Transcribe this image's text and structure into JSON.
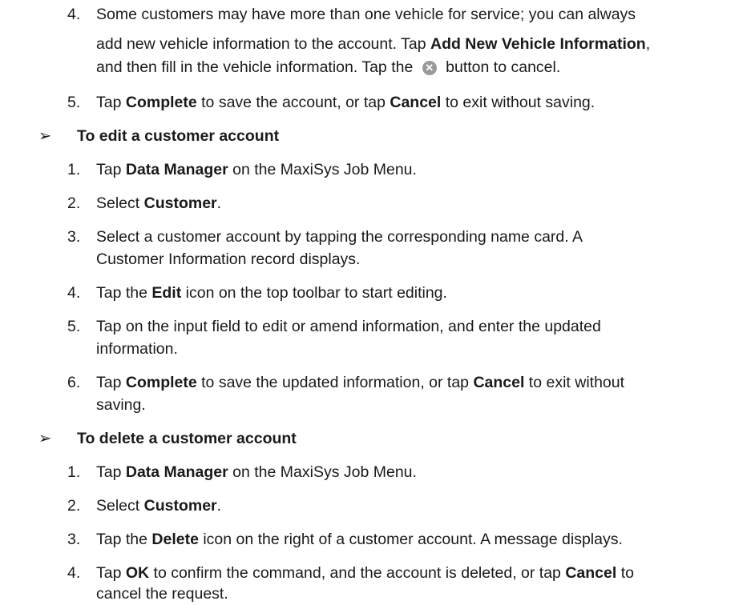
{
  "pre_steps": [
    {
      "num": "4.",
      "line1_a": "Some customers may have more than one vehicle for service; you can always",
      "line2_a": "add new vehicle information to the account. Tap ",
      "line2_bold": "Add New Vehicle Information",
      "line2_c": ",",
      "line3_a": "and then fill in the vehicle information. Tap the",
      "icon": "cancel-icon",
      "line3_c": "button to cancel."
    },
    {
      "num": "5.",
      "a": "Tap ",
      "b1": "Complete",
      "c": " to save the account, or tap ",
      "b2": "Cancel",
      "d": " to exit without saving."
    }
  ],
  "edit_section": {
    "heading": "To edit a customer account",
    "steps": [
      {
        "num": "1.",
        "a": "Tap ",
        "b": "Data Manager",
        "c": " on the MaxiSys Job Menu."
      },
      {
        "num": "2.",
        "a": "Select ",
        "b": "Customer",
        "c": "."
      },
      {
        "num": "3.",
        "line1": "Select a customer account by tapping the corresponding name card. A",
        "line2": "Customer Information record displays."
      },
      {
        "num": "4.",
        "a": "Tap the ",
        "b": "Edit",
        "c": " icon on the top toolbar to start editing."
      },
      {
        "num": "5.",
        "line1": "Tap on the input field to edit or amend information, and enter the updated",
        "line2": "information."
      },
      {
        "num": "6.",
        "a": "Tap ",
        "b1": "Complete",
        "c": " to save the updated information, or tap ",
        "b2": "Cancel",
        "d": " to exit without",
        "line2": "saving."
      }
    ]
  },
  "delete_section": {
    "heading": "To delete a customer account",
    "steps": [
      {
        "num": "1.",
        "a": "Tap ",
        "b": "Data Manager",
        "c": " on the MaxiSys Job Menu."
      },
      {
        "num": "2.",
        "a": "Select ",
        "b": "Customer",
        "c": "."
      },
      {
        "num": "3.",
        "a": "Tap the ",
        "b": "Delete",
        "c": " icon on the right of a customer account. A message displays."
      },
      {
        "num": "4.",
        "a": "Tap ",
        "b1": "OK",
        "c": " to confirm the command, and the account is deleted, or tap ",
        "b2": "Cancel",
        "d": " to",
        "line2": "cancel the request."
      }
    ]
  }
}
